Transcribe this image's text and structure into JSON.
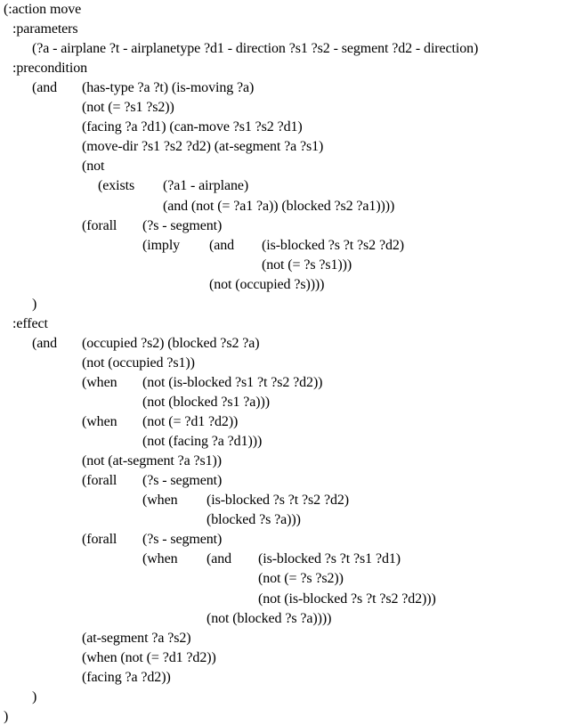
{
  "listing": {
    "language": "PDDL",
    "lines": [
      {
        "segments": [
          {
            "col": 0,
            "text": "(:action move"
          }
        ]
      },
      {
        "segments": [
          {
            "col": 1,
            "text": ":parameters"
          }
        ]
      },
      {
        "segments": [
          {
            "col": 2,
            "text": "(?a - airplane ?t - airplanetype ?d1 - direction ?s1 ?s2 - segment ?d2 - direction)"
          }
        ]
      },
      {
        "segments": [
          {
            "col": 1,
            "text": ":precondition"
          }
        ]
      },
      {
        "segments": [
          {
            "col": 2,
            "text": "(and"
          },
          {
            "col": 3,
            "text": "(has-type ?a ?t) (is-moving ?a)"
          }
        ]
      },
      {
        "segments": [
          {
            "col": 3,
            "text": "(not (= ?s1 ?s2))"
          }
        ]
      },
      {
        "segments": [
          {
            "col": 3,
            "text": "(facing ?a ?d1) (can-move ?s1 ?s2 ?d1)"
          }
        ]
      },
      {
        "segments": [
          {
            "col": 3,
            "text": "(move-dir ?s1 ?s2 ?d2) (at-segment ?a ?s1)"
          }
        ]
      },
      {
        "segments": [
          {
            "col": 3,
            "text": "(not"
          }
        ]
      },
      {
        "segments": [
          {
            "col": "3b",
            "text": "(exists"
          },
          {
            "col": "4b",
            "text": "(?a1 - airplane)"
          }
        ]
      },
      {
        "segments": [
          {
            "col": "4b",
            "text": "(and (not (= ?a1 ?a)) (blocked ?s2 ?a1))))"
          }
        ]
      },
      {
        "segments": [
          {
            "col": 3,
            "text": "(forall"
          },
          {
            "col": 4,
            "text": "(?s - segment)"
          }
        ]
      },
      {
        "segments": [
          {
            "col": 4,
            "text": "(imply"
          },
          {
            "col": 5,
            "text": "(and"
          },
          {
            "col": 6,
            "text": "(is-blocked ?s ?t ?s2 ?d2)"
          }
        ]
      },
      {
        "segments": [
          {
            "col": 6,
            "text": "(not (= ?s ?s1)))"
          }
        ]
      },
      {
        "segments": [
          {
            "col": 5,
            "text": "(not (occupied ?s))))"
          }
        ]
      },
      {
        "segments": [
          {
            "col": 2,
            "text": ")"
          }
        ]
      },
      {
        "segments": [
          {
            "col": 1,
            "text": ":effect"
          }
        ]
      },
      {
        "segments": [
          {
            "col": 2,
            "text": "(and"
          },
          {
            "col": 3,
            "text": "(occupied ?s2) (blocked ?s2 ?a)"
          }
        ]
      },
      {
        "segments": [
          {
            "col": 3,
            "text": "(not (occupied ?s1))"
          }
        ]
      },
      {
        "segments": [
          {
            "col": 3,
            "text": "(when"
          },
          {
            "col": 4,
            "text": "(not (is-blocked ?s1 ?t ?s2 ?d2))"
          }
        ]
      },
      {
        "segments": [
          {
            "col": 4,
            "text": "(not (blocked ?s1 ?a)))"
          }
        ]
      },
      {
        "segments": [
          {
            "col": 3,
            "text": "(when"
          },
          {
            "col": 4,
            "text": "(not (= ?d1 ?d2))"
          }
        ]
      },
      {
        "segments": [
          {
            "col": 4,
            "text": "(not (facing ?a ?d1)))"
          }
        ]
      },
      {
        "segments": [
          {
            "col": 3,
            "text": "(not (at-segment ?a ?s1))"
          }
        ]
      },
      {
        "segments": [
          {
            "col": 3,
            "text": "(forall"
          },
          {
            "col": 4,
            "text": "(?s - segment)"
          }
        ]
      },
      {
        "segments": [
          {
            "col": 4,
            "text": "(when"
          },
          {
            "col": "5w",
            "text": "(is-blocked ?s ?t ?s2 ?d2)"
          }
        ]
      },
      {
        "segments": [
          {
            "col": "5w",
            "text": "(blocked ?s ?a)))"
          }
        ]
      },
      {
        "segments": [
          {
            "col": 3,
            "text": "(forall"
          },
          {
            "col": 4,
            "text": "(?s - segment)"
          }
        ]
      },
      {
        "segments": [
          {
            "col": 4,
            "text": "(when"
          },
          {
            "col": "5w",
            "text": "(and"
          },
          {
            "col": "6w",
            "text": "(is-blocked ?s ?t ?s1 ?d1)"
          }
        ]
      },
      {
        "segments": [
          {
            "col": "6w",
            "text": "(not (= ?s ?s2))"
          }
        ]
      },
      {
        "segments": [
          {
            "col": "6w",
            "text": "(not (is-blocked ?s ?t ?s2 ?d2)))"
          }
        ]
      },
      {
        "segments": [
          {
            "col": "5w",
            "text": "(not (blocked ?s ?a))))"
          }
        ]
      },
      {
        "segments": [
          {
            "col": 3,
            "text": "(at-segment ?a ?s2)"
          }
        ]
      },
      {
        "segments": [
          {
            "col": 3,
            "text": "(when (not (= ?d1 ?d2))"
          }
        ]
      },
      {
        "segments": [
          {
            "col": 3,
            "text": "(facing ?a ?d2))"
          }
        ]
      },
      {
        "segments": [
          {
            "col": 2,
            "text": ")"
          }
        ]
      },
      {
        "segments": [
          {
            "col": 0,
            "text": ")"
          }
        ]
      }
    ]
  }
}
